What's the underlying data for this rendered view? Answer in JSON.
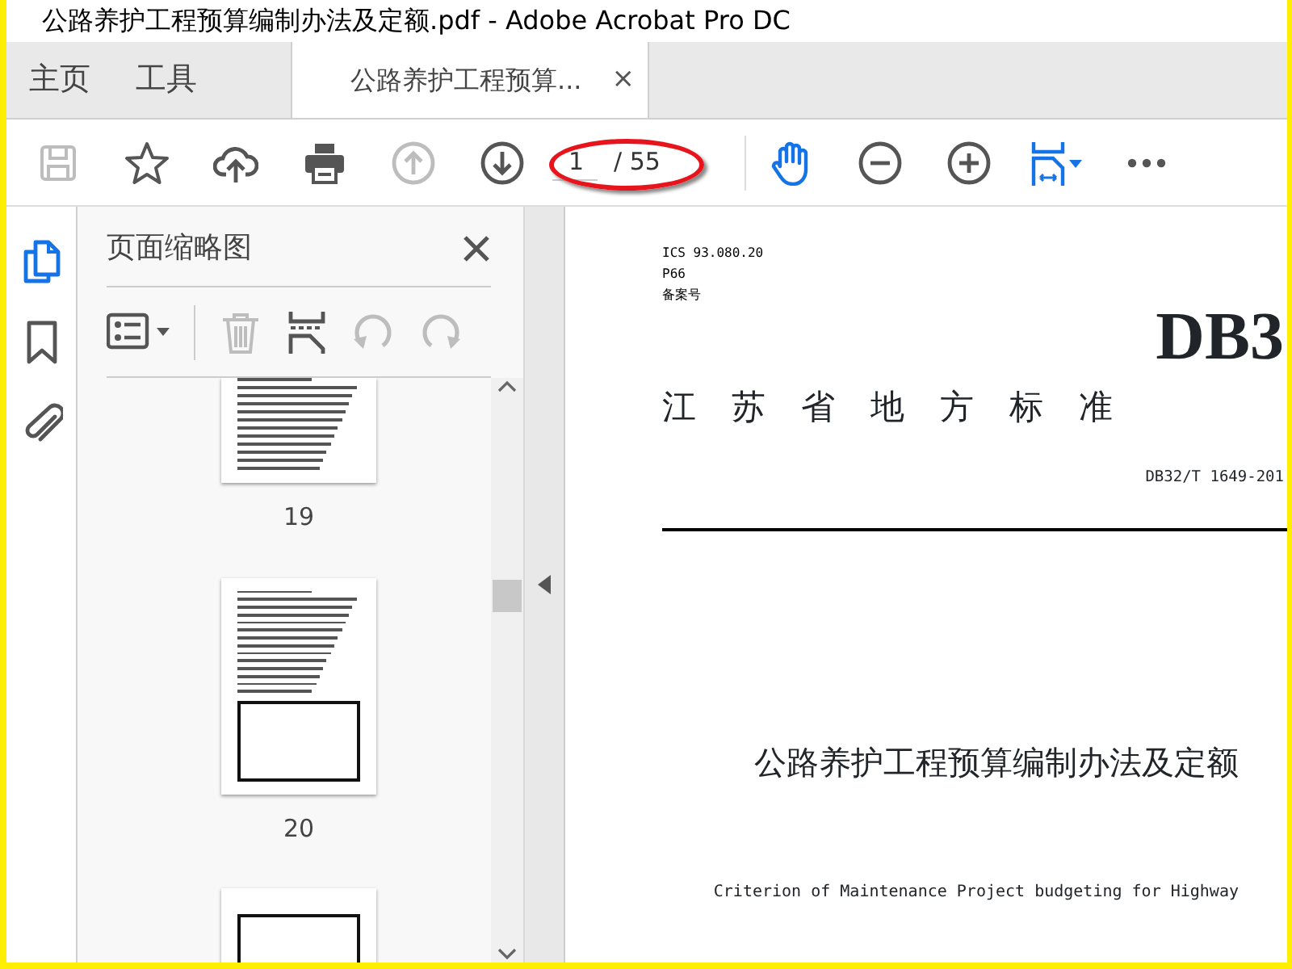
{
  "window": {
    "title": "公路养护工程预算编制办法及定额.pdf - Adobe Acrobat Pro DC"
  },
  "tabs": [
    {
      "label": "主页",
      "kind": "nav",
      "selected": false
    },
    {
      "label": "工具",
      "kind": "nav",
      "selected": false
    },
    {
      "label": "公路养护工程预算...",
      "kind": "document",
      "selected": true,
      "close": "×"
    }
  ],
  "toolbar": {
    "tools": [
      {
        "kind": "save",
        "disabled": true,
        "selected": false
      },
      {
        "kind": "star",
        "disabled": false,
        "selected": false
      },
      {
        "kind": "upload",
        "disabled": false,
        "selected": false
      },
      {
        "kind": "print",
        "disabled": false,
        "selected": false
      },
      {
        "kind": "prev",
        "disabled": true,
        "selected": false
      },
      {
        "kind": "next",
        "disabled": false,
        "selected": false
      },
      {
        "kind": "page",
        "value": "1",
        "count": "/ 55"
      },
      {
        "kind": "hand",
        "disabled": false,
        "selected": true
      },
      {
        "kind": "zoomout",
        "disabled": false,
        "selected": false
      },
      {
        "kind": "zoomin",
        "disabled": false,
        "selected": false
      },
      {
        "kind": "fit",
        "disabled": false,
        "selected": true
      },
      {
        "kind": "more",
        "disabled": false,
        "selected": false
      }
    ],
    "annotation": {
      "circled": true
    }
  },
  "sidebar": {
    "items": [
      {
        "kind": "pages",
        "selected": true
      },
      {
        "kind": "bookmarks",
        "selected": false
      },
      {
        "kind": "attachments",
        "selected": false
      }
    ]
  },
  "panel": {
    "title": "页面缩略图",
    "tools": [
      {
        "kind": "options",
        "disabled": false
      },
      {
        "kind": "delete",
        "disabled": true
      },
      {
        "kind": "insert",
        "disabled": false
      },
      {
        "kind": "undo",
        "disabled": true
      },
      {
        "kind": "redo",
        "disabled": true
      }
    ],
    "thumbnails": [
      {
        "label": "19",
        "kind": "text"
      },
      {
        "label": "20",
        "kind": "table"
      }
    ],
    "partial_thumbnail": true
  },
  "document": {
    "ics": "ICS 93.080.20",
    "class": "P66",
    "record": "备案号",
    "mark": "DB3",
    "issuer": "江苏省地方标准",
    "code": "DB32/T 1649-201",
    "title": "公路养护工程预算编制办法及定额",
    "subtitle": "Criterion of Maintenance Project budgeting for Highway"
  }
}
